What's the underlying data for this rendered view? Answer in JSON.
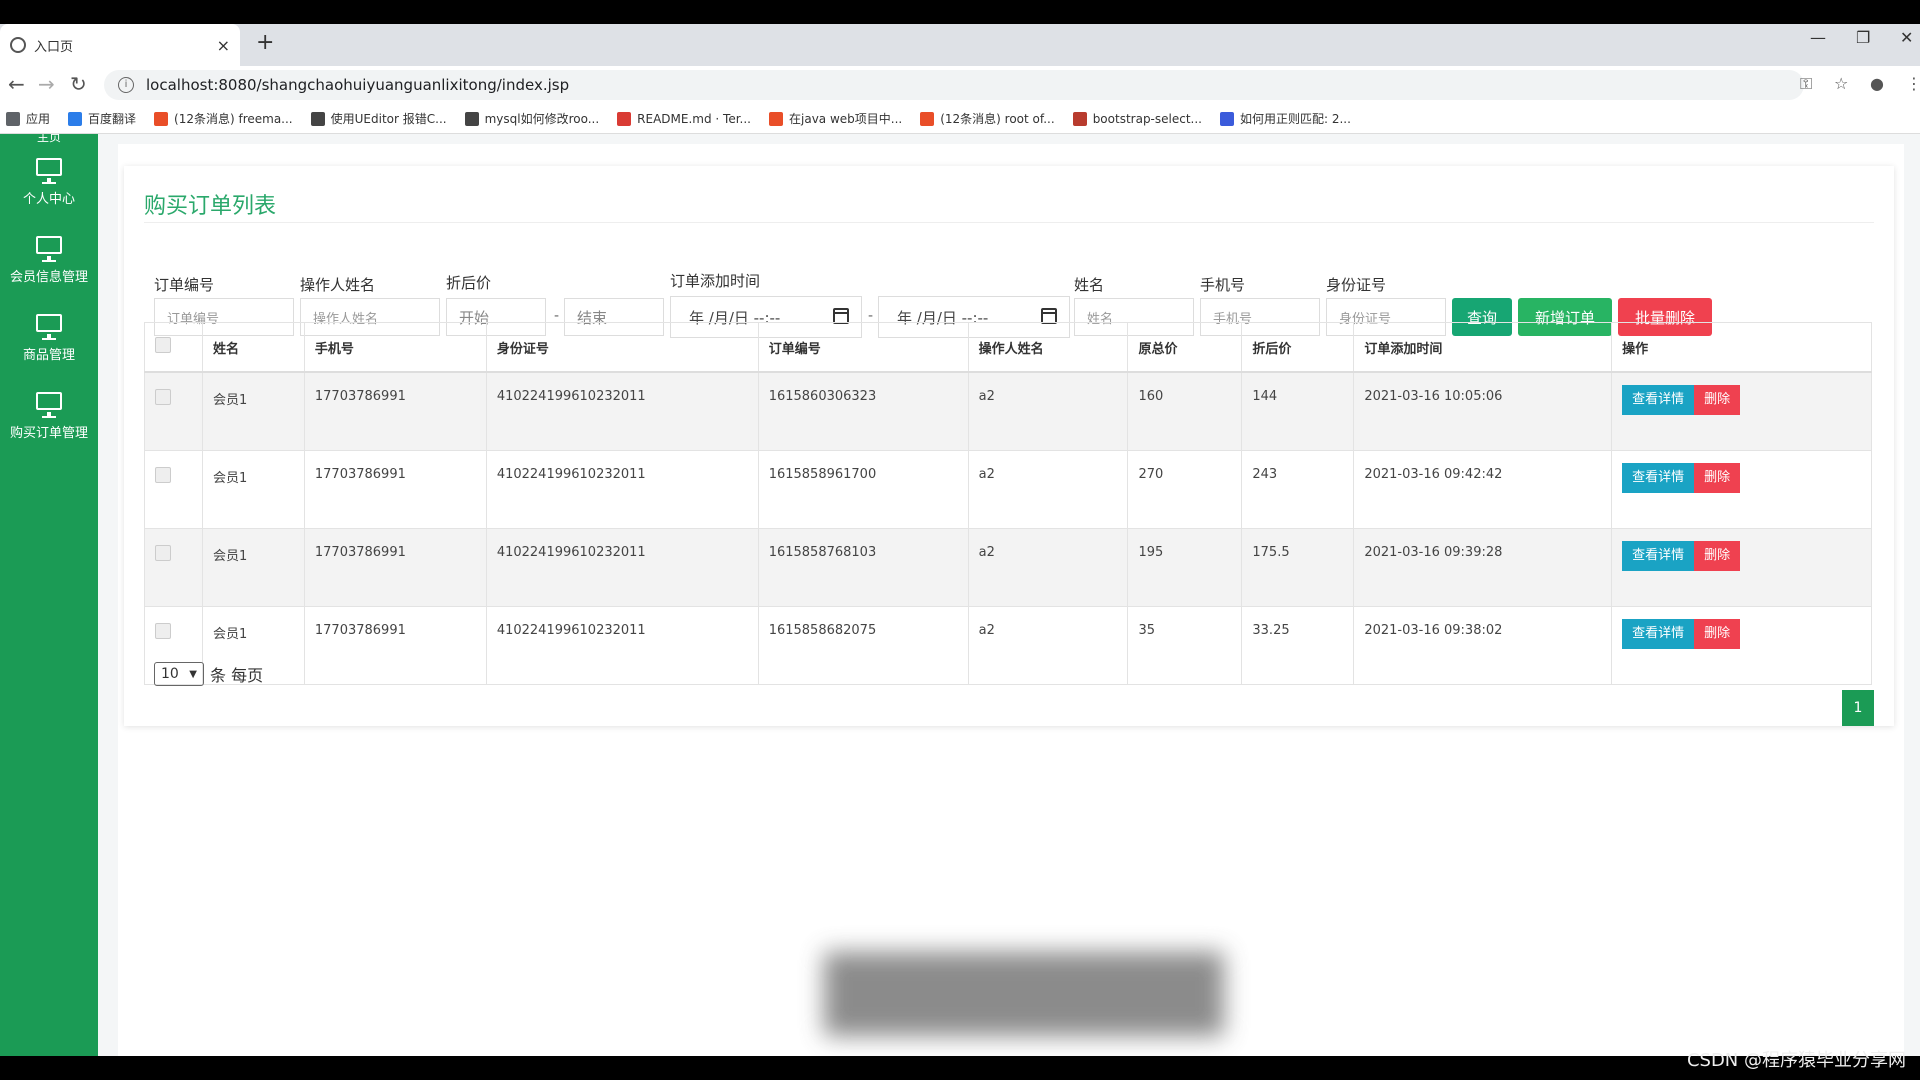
{
  "browser": {
    "tab_title": "入口页",
    "tab_close": "×",
    "new_tab": "+",
    "url": "localhost:8080/shangchaohuiyuanguanlixitong/index.jsp",
    "bookmarks": [
      {
        "label": "应用",
        "color": "#5f6368"
      },
      {
        "label": "百度翻译",
        "color": "#2b7de9"
      },
      {
        "label": "(12条消息) freema...",
        "color": "#e94e28"
      },
      {
        "label": "使用UEditor 报错C...",
        "color": "#444444"
      },
      {
        "label": "mysql如何修改roo...",
        "color": "#444444"
      },
      {
        "label": "README.md · Ter...",
        "color": "#d93b34"
      },
      {
        "label": "在java web项目中...",
        "color": "#e94e28"
      },
      {
        "label": "(12条消息) root of...",
        "color": "#e94e28"
      },
      {
        "label": "bootstrap-select...",
        "color": "#b83b2e"
      },
      {
        "label": "如何用正则匹配: 2...",
        "color": "#3b5bdb"
      }
    ]
  },
  "sidebar": {
    "top_label": "主页",
    "items": [
      {
        "label": "个人中心"
      },
      {
        "label": "会员信息管理"
      },
      {
        "label": "商品管理"
      },
      {
        "label": "购买订单管理"
      }
    ]
  },
  "main": {
    "title": "购买订单列表",
    "filters": {
      "order_no_label": "订单编号",
      "order_no_placeholder": "订单编号",
      "operator_label": "操作人姓名",
      "operator_placeholder": "操作人姓名",
      "discount_label": "折后价",
      "discount_start": "开始",
      "discount_end": "结束",
      "range_sep": "-",
      "time_label": "订单添加时间",
      "date_placeholder": "年 /月/日 --:--",
      "name_label": "姓名",
      "name_placeholder": "姓名",
      "phone_label": "手机号",
      "phone_placeholder": "手机号",
      "idcard_label": "身份证号",
      "idcard_placeholder": "身份证号"
    },
    "buttons": {
      "query": "查询",
      "add": "新增订单",
      "batch_delete": "批量删除"
    },
    "table": {
      "headers": [
        "姓名",
        "手机号",
        "身份证号",
        "订单编号",
        "操作人姓名",
        "原总价",
        "折后价",
        "订单添加时间",
        "操作"
      ],
      "rows": [
        {
          "name": "会员1",
          "phone": "17703786991",
          "idcard": "410224199610232011",
          "order_no": "1615860306323",
          "operator": "a2",
          "total": "160",
          "discount": "144",
          "time": "2021-03-16 10:05:06"
        },
        {
          "name": "会员1",
          "phone": "17703786991",
          "idcard": "410224199610232011",
          "order_no": "1615858961700",
          "operator": "a2",
          "total": "270",
          "discount": "243",
          "time": "2021-03-16 09:42:42"
        },
        {
          "name": "会员1",
          "phone": "17703786991",
          "idcard": "410224199610232011",
          "order_no": "1615858768103",
          "operator": "a2",
          "total": "195",
          "discount": "175.5",
          "time": "2021-03-16 09:39:28"
        },
        {
          "name": "会员1",
          "phone": "17703786991",
          "idcard": "410224199610232011",
          "order_no": "1615858682075",
          "operator": "a2",
          "total": "35",
          "discount": "33.25",
          "time": "2021-03-16 09:38:02"
        }
      ],
      "view_label": "查看详情",
      "delete_label": "删除"
    },
    "pagination": {
      "page_size": "10",
      "page_size_suffix": "条 每页",
      "current_page": "1"
    }
  },
  "watermark": "CSDN @程序猿毕业分享网",
  "colors": {
    "sidebar": "#1b9b55",
    "title": "#2aa86b",
    "query_btn": "#17a673",
    "add_btn": "#28b463",
    "delete_btn": "#f0414f",
    "view_btn": "#1aa3c4",
    "row_delete_btn": "#ef4150"
  }
}
